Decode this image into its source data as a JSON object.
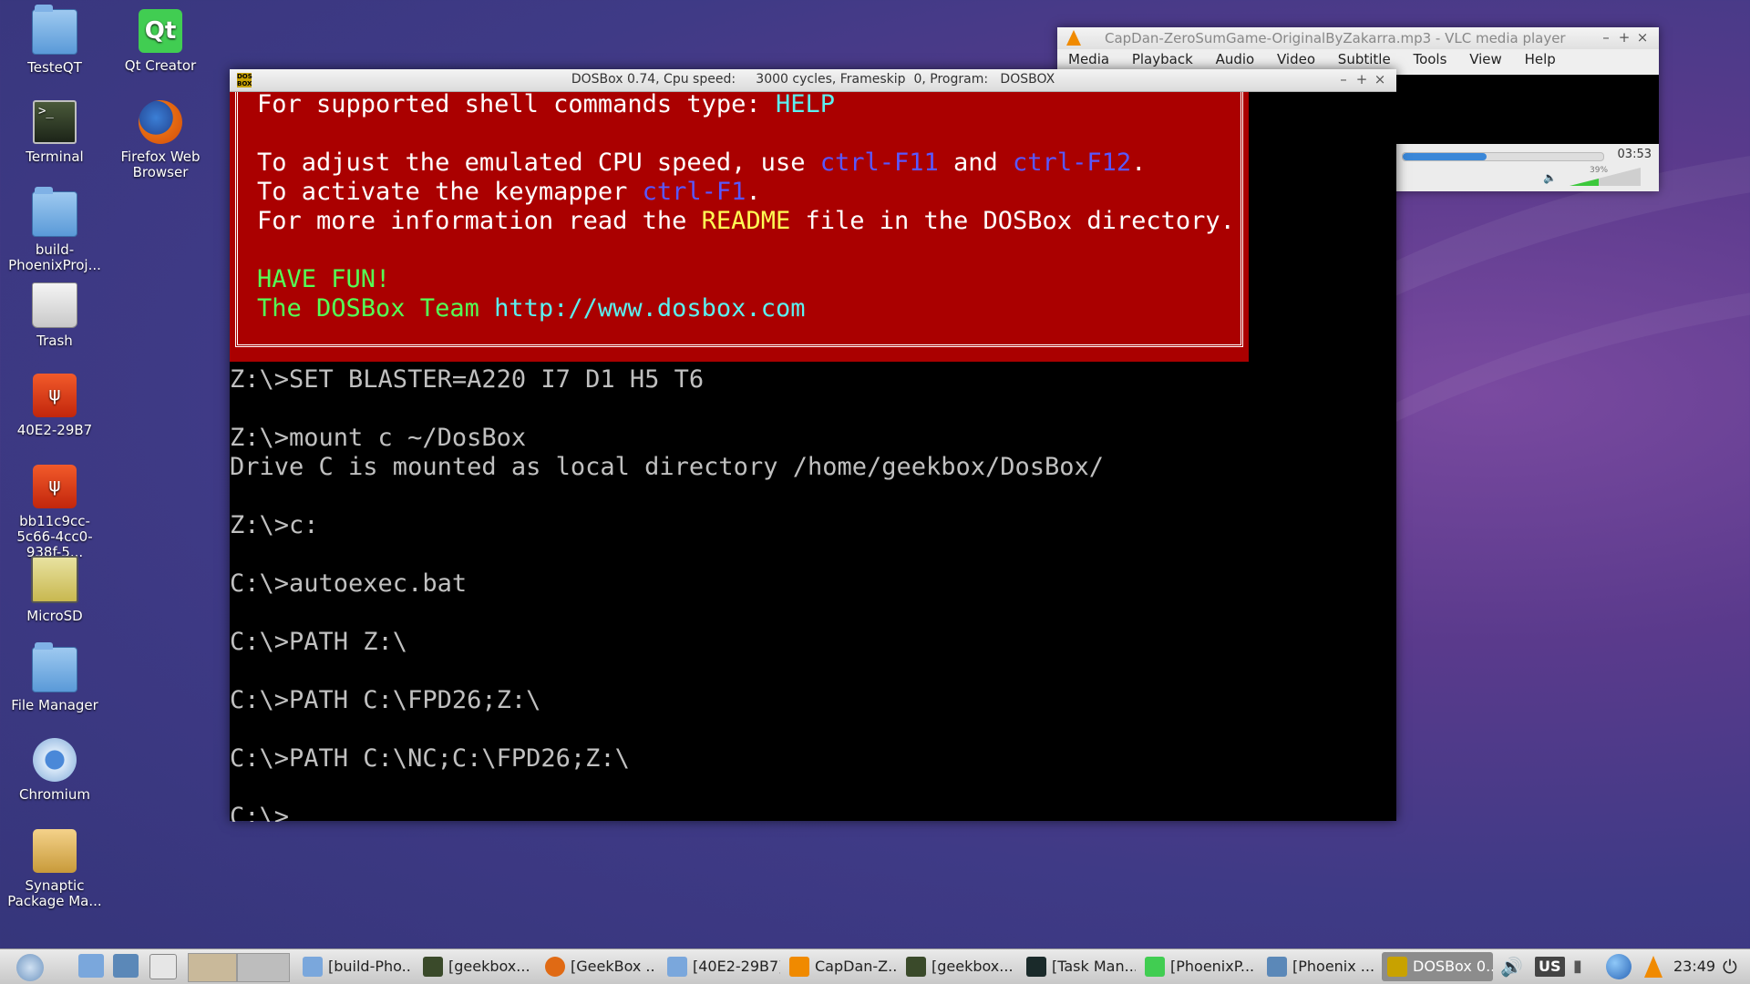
{
  "desktop_icons": [
    {
      "label": "TesteQT",
      "icon": "folder-icon"
    },
    {
      "label": "Qt Creator",
      "icon": "qt-creator-icon"
    },
    {
      "label": "Terminal",
      "icon": "terminal-icon"
    },
    {
      "label": "Firefox Web Browser",
      "icon": "firefox-icon"
    },
    {
      "label": "build-PhoenixProj...",
      "icon": "folder-icon"
    },
    {
      "label": "Trash",
      "icon": "trash-icon"
    },
    {
      "label": "40E2-29B7",
      "icon": "usb-drive-icon"
    },
    {
      "label": "bb11c9cc-5c66-4cc0-938f-5...",
      "icon": "usb-drive-icon"
    },
    {
      "label": "MicroSD",
      "icon": "sd-card-icon"
    },
    {
      "label": "File Manager",
      "icon": "file-manager-icon"
    },
    {
      "label": "Chromium",
      "icon": "chromium-icon"
    },
    {
      "label": "Synaptic Package Ma...",
      "icon": "synaptic-icon"
    }
  ],
  "dosbox": {
    "title": "DOSBox 0.74, Cpu speed:     3000 cycles, Frameskip  0, Program:   DOSBOX",
    "banner": {
      "line1_prefix": "For supported shell commands type: ",
      "line1_help": "HELP",
      "line2_prefix": "To adjust the emulated CPU speed, use ",
      "line2_key1": "ctrl-F11",
      "line2_mid": " and ",
      "line2_key2": "ctrl-F12",
      "line2_suffix": ".",
      "line3_prefix": "To activate the keymapper ",
      "line3_key": "ctrl-F1",
      "line3_suffix": ".",
      "line4_prefix": "For more information read the ",
      "line4_readme": "README",
      "line4_suffix": " file in the DOSBox directory.",
      "have_fun": "HAVE FUN!",
      "team": "The DOSBox Team ",
      "url": "http://www.dosbox.com"
    },
    "console_lines": [
      "Z:\\>SET BLASTER=A220 I7 D1 H5 T6",
      "Z:\\>mount c ~/DosBox",
      "Drive C is mounted as local directory /home/geekbox/DosBox/",
      "Z:\\>c:",
      "C:\\>autoexec.bat",
      "C:\\>PATH Z:\\",
      "C:\\>PATH C:\\FPD26;Z:\\",
      "C:\\>PATH C:\\NC;C:\\FPD26;Z:\\",
      "C:\\>"
    ]
  },
  "vlc": {
    "title": "CapDan-ZeroSumGame-OriginalByZakarra.mp3 - VLC media player",
    "menu": [
      "Media",
      "Playback",
      "Audio",
      "Video",
      "Subtitle",
      "Tools",
      "View",
      "Help"
    ],
    "time": "03:53",
    "volume": "39%",
    "progress": 0.42
  },
  "taskbar": {
    "tasks": [
      {
        "label": "[build-Pho...",
        "active": false
      },
      {
        "label": "[geekbox...",
        "active": false
      },
      {
        "label": "[GeekBox ...",
        "active": false
      },
      {
        "label": "[40E2-29B7]",
        "active": false
      },
      {
        "label": "CapDan-Z...",
        "active": false
      },
      {
        "label": "[geekbox...",
        "active": false
      },
      {
        "label": "[Task Man...",
        "active": false
      },
      {
        "label": "[PhoenixP...",
        "active": false
      },
      {
        "label": "[Phoenix ...",
        "active": false
      },
      {
        "label": "DOSBox 0...",
        "active": true
      }
    ],
    "keyboard_layout": "US",
    "clock": "23:49"
  },
  "colors": {
    "banner_red": "#aa0000",
    "dos_cyan": "#5cf0f0",
    "dos_blue": "#5858ff",
    "dos_yellow": "#ffff55",
    "dos_green": "#55ff55"
  }
}
